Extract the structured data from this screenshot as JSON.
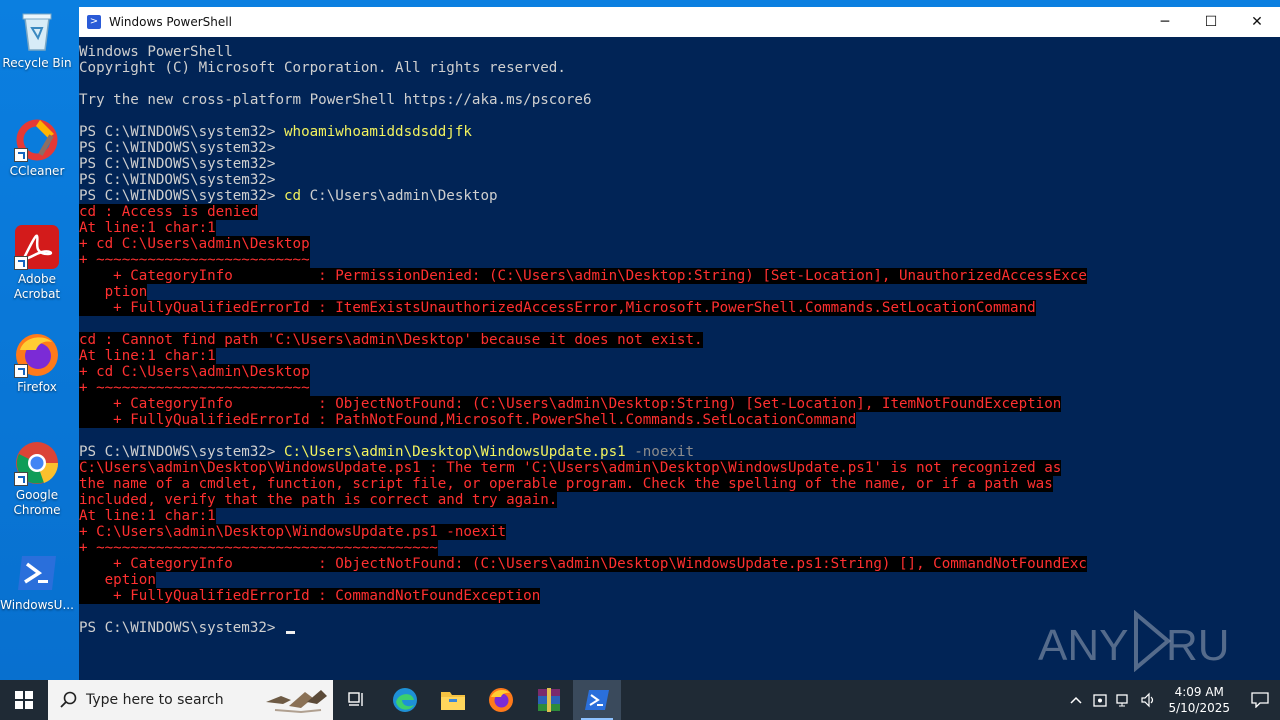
{
  "desktop": {
    "icons": [
      {
        "label": "Recycle Bin"
      },
      {
        "label": "CCleaner"
      },
      {
        "label": "Adobe Acrobat"
      },
      {
        "label": "Firefox"
      },
      {
        "label": "Google Chrome"
      },
      {
        "label": "WindowsU..."
      }
    ]
  },
  "window": {
    "title": "Windows PowerShell",
    "controls": {
      "minimize": "─",
      "maximize": "☐",
      "close": "✕"
    }
  },
  "console": {
    "lines": [
      {
        "t": "Windows PowerShell"
      },
      {
        "t": "Copyright (C) Microsoft Corporation. All rights reserved."
      },
      {
        "t": ""
      },
      {
        "t": "Try the new cross-platform PowerShell https://aka.ms/pscore6"
      },
      {
        "t": ""
      },
      {
        "p": "PS C:\\WINDOWS\\system32> ",
        "cmd": "whoamiwhoamiddsdsddjfk"
      },
      {
        "p": "PS C:\\WINDOWS\\system32>"
      },
      {
        "p": "PS C:\\WINDOWS\\system32>"
      },
      {
        "p": "PS C:\\WINDOWS\\system32>"
      },
      {
        "p": "PS C:\\WINDOWS\\system32> ",
        "cmd": "cd",
        "arg": " C:\\Users\\admin\\Desktop"
      },
      {
        "e": "cd : Access is denied"
      },
      {
        "e": "At line:1 char:1"
      },
      {
        "e": "+ cd C:\\Users\\admin\\Desktop"
      },
      {
        "e": "+ ~~~~~~~~~~~~~~~~~~~~~~~~~"
      },
      {
        "e": "    + CategoryInfo          : PermissionDenied: (C:\\Users\\admin\\Desktop:String) [Set-Location], UnauthorizedAccessExce"
      },
      {
        "e": "   ption"
      },
      {
        "e": "    + FullyQualifiedErrorId : ItemExistsUnauthorizedAccessError,Microsoft.PowerShell.Commands.SetLocationCommand"
      },
      {
        "t": ""
      },
      {
        "e": "cd : Cannot find path 'C:\\Users\\admin\\Desktop' because it does not exist."
      },
      {
        "e": "At line:1 char:1"
      },
      {
        "e": "+ cd C:\\Users\\admin\\Desktop"
      },
      {
        "e": "+ ~~~~~~~~~~~~~~~~~~~~~~~~~"
      },
      {
        "e": "    + CategoryInfo          : ObjectNotFound: (C:\\Users\\admin\\Desktop:String) [Set-Location], ItemNotFoundException"
      },
      {
        "e": "    + FullyQualifiedErrorId : PathNotFound,Microsoft.PowerShell.Commands.SetLocationCommand"
      },
      {
        "t": ""
      },
      {
        "p": "PS C:\\WINDOWS\\system32> ",
        "cmd": "C:\\Users\\admin\\Desktop\\WindowsUpdate.ps1",
        "opt": " -noexit"
      },
      {
        "e": "C:\\Users\\admin\\Desktop\\WindowsUpdate.ps1 : The term 'C:\\Users\\admin\\Desktop\\WindowsUpdate.ps1' is not recognized as"
      },
      {
        "e": "the name of a cmdlet, function, script file, or operable program. Check the spelling of the name, or if a path was"
      },
      {
        "e": "included, verify that the path is correct and try again."
      },
      {
        "e": "At line:1 char:1"
      },
      {
        "e": "+ C:\\Users\\admin\\Desktop\\WindowsUpdate.ps1 -noexit"
      },
      {
        "e": "+ ~~~~~~~~~~~~~~~~~~~~~~~~~~~~~~~~~~~~~~~~"
      },
      {
        "e": "    + CategoryInfo          : ObjectNotFound: (C:\\Users\\admin\\Desktop\\WindowsUpdate.ps1:String) [], CommandNotFoundExc"
      },
      {
        "e": "   eption"
      },
      {
        "e": "    + FullyQualifiedErrorId : CommandNotFoundException"
      },
      {
        "t": ""
      },
      {
        "p": "PS C:\\WINDOWS\\system32> ",
        "cursor": true
      }
    ]
  },
  "watermark": {
    "text": "ANY RUN"
  },
  "taskbar": {
    "search_placeholder": "Type here to search",
    "apps": [
      "task-view",
      "edge",
      "file-explorer",
      "firefox",
      "winrar",
      "powershell"
    ],
    "clock": {
      "time": "4:09 AM",
      "date": "5/10/2025"
    }
  },
  "colors": {
    "console_bg": "#012456",
    "error_fg": "#ff3030",
    "command_fg": "#f2f25e",
    "desktop_bg": "#0b7fe0",
    "taskbar_bg": "#1f2a35"
  }
}
